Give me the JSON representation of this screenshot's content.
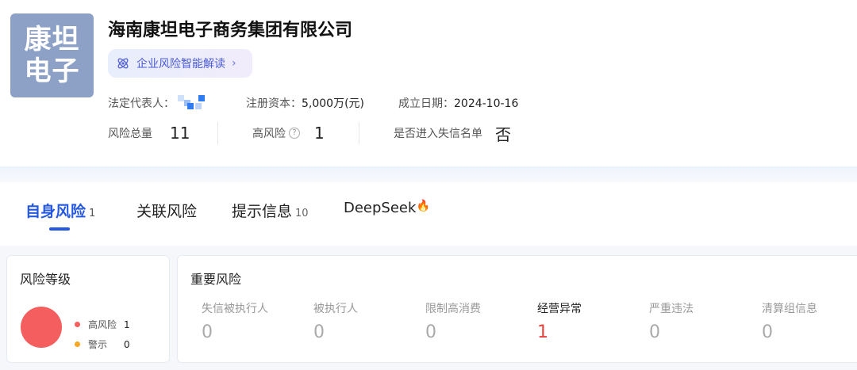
{
  "company": {
    "logo_line1": "康坦",
    "logo_line2": "电子",
    "name": "海南康坦电子商务集团有限公司",
    "ai_button_label": "企业风险智能解读",
    "legal_rep_label": "法定代表人：",
    "capital_label": "注册资本：",
    "capital_value": "5,000万(元)",
    "founded_label": "成立日期：",
    "founded_value": "2024-10-16"
  },
  "stats": {
    "total_label": "风险总量",
    "total_value": "11",
    "high_label": "高风险",
    "high_value": "1",
    "blacklist_label": "是否进入失信名单",
    "blacklist_value": "否"
  },
  "tabs": [
    {
      "label": "自身风险",
      "count": "1",
      "active": true
    },
    {
      "label": "关联风险",
      "count": ""
    },
    {
      "label": "提示信息",
      "count": "10"
    },
    {
      "label": "DeepSeek",
      "count": ""
    }
  ],
  "risk_level": {
    "title": "风险等级",
    "items": [
      {
        "label": "高风险",
        "value": "1",
        "color": "#f55e5e"
      },
      {
        "label": "警示",
        "value": "0",
        "color": "#f5a623"
      }
    ]
  },
  "important_risk": {
    "title": "重要风险",
    "items": [
      {
        "label": "失信被执行人",
        "value": "0"
      },
      {
        "label": "被执行人",
        "value": "0"
      },
      {
        "label": "限制高消费",
        "value": "0"
      },
      {
        "label": "经营异常",
        "value": "1"
      },
      {
        "label": "严重违法",
        "value": "0"
      },
      {
        "label": "清算组信息",
        "value": "0"
      }
    ]
  },
  "colors": {
    "accent": "#2458e0",
    "logo_bg": "#8da1c7",
    "danger": "#e4423b"
  }
}
